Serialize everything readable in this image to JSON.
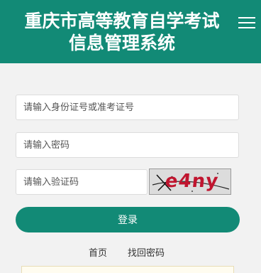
{
  "header": {
    "title_line1": "重庆市高等教育自学考试",
    "title_line2": "信息管理系统",
    "background": "#128a76",
    "menu_icon": "hamburger-menu-icon"
  },
  "form": {
    "id_placeholder": "请输入身份证号或准考证号",
    "password_placeholder": "请输入密码",
    "captcha_placeholder": "请输入验证码",
    "captcha_text": "e4ny",
    "login_label": "登录"
  },
  "links": {
    "home": "首页",
    "recover_password": "找回密码"
  }
}
